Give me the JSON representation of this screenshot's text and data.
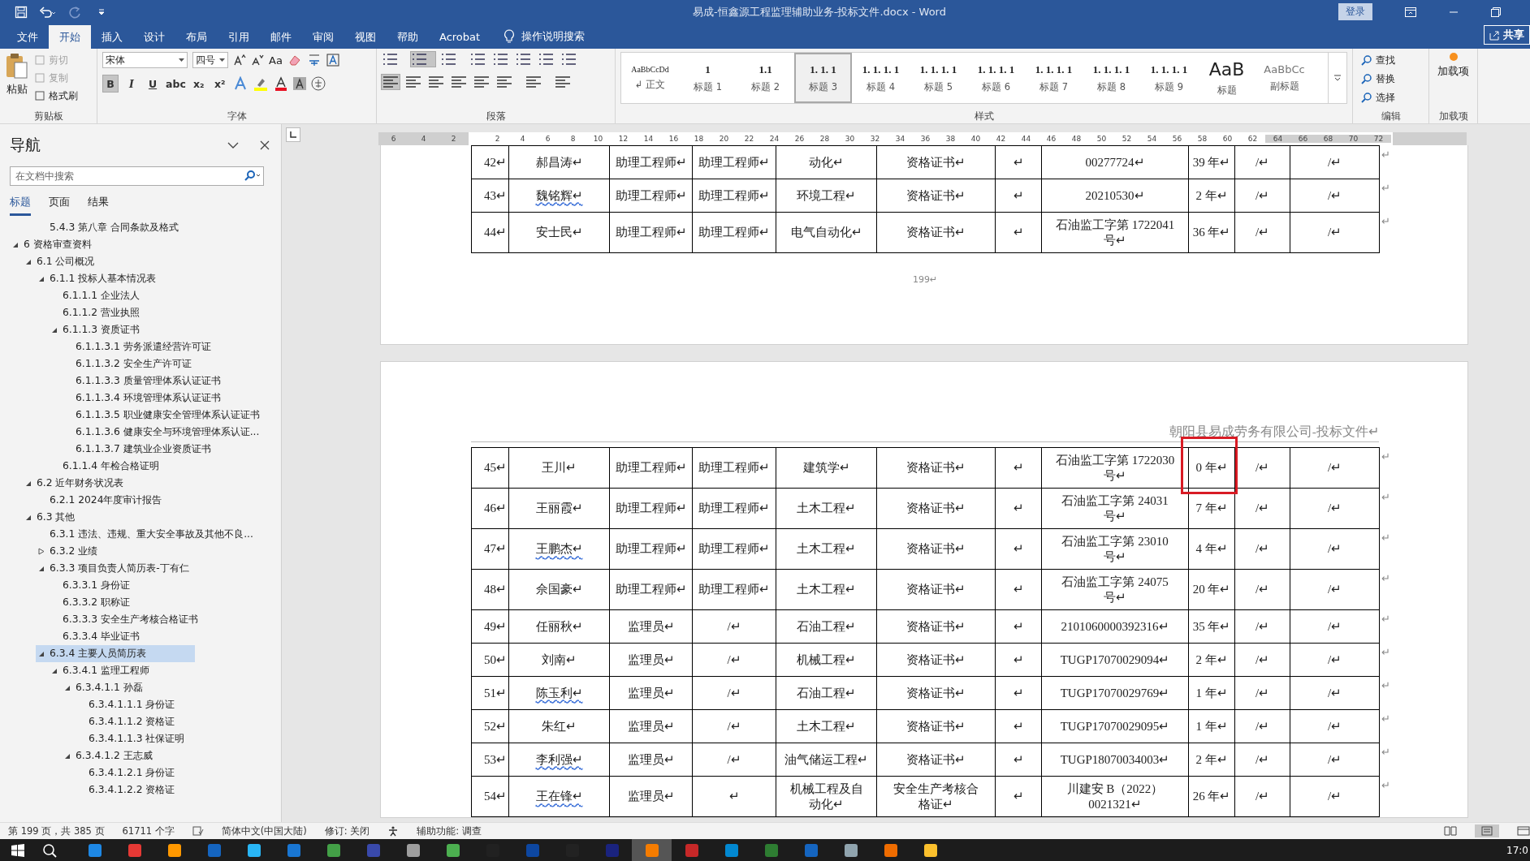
{
  "window": {
    "title": "易成-恒鑫源工程监理辅助业务-投标文件.docx  -  Word",
    "sign_in": "登录"
  },
  "menu_tabs": [
    {
      "label": "文件",
      "selected": false
    },
    {
      "label": "开始",
      "selected": true
    },
    {
      "label": "插入",
      "selected": false
    },
    {
      "label": "设计",
      "selected": false
    },
    {
      "label": "布局",
      "selected": false
    },
    {
      "label": "引用",
      "selected": false
    },
    {
      "label": "邮件",
      "selected": false
    },
    {
      "label": "审阅",
      "selected": false
    },
    {
      "label": "视图",
      "selected": false
    },
    {
      "label": "帮助",
      "selected": false
    },
    {
      "label": "Acrobat",
      "selected": false
    }
  ],
  "tell_me": "操作说明搜索",
  "share": "共享",
  "ribbon": {
    "clipboard": {
      "paste": "粘贴",
      "items": [
        {
          "label": "剪切",
          "disabled": true
        },
        {
          "label": "复制",
          "disabled": true
        },
        {
          "label": "格式刷",
          "disabled": false
        }
      ],
      "group": "剪贴板"
    },
    "font": {
      "name": "宋体",
      "size": "四号",
      "case_button": "Aa",
      "format_buttons": [
        {
          "label": "B",
          "selected": true
        },
        {
          "label": "I",
          "selected": false
        },
        {
          "label": "U",
          "selected": false
        },
        {
          "label": "abc",
          "selected": false
        },
        {
          "label": "x₂",
          "selected": false
        },
        {
          "label": "x²",
          "selected": false
        }
      ],
      "group": "字体"
    },
    "paragraph": {
      "group": "段落"
    },
    "styles": {
      "items": [
        {
          "preview": "AaBbCcDd",
          "name": "↲ 正文",
          "selected": false
        },
        {
          "preview": "1",
          "name": "标题 1",
          "selected": false
        },
        {
          "preview": "1.1",
          "name": "标题 2",
          "selected": false
        },
        {
          "preview": "1. 1. 1",
          "name": "标题 3",
          "selected": true
        },
        {
          "preview": "1. 1. 1. 1",
          "name": "标题 4",
          "selected": false
        },
        {
          "preview": "1. 1. 1. 1",
          "name": "标题 5",
          "selected": false
        },
        {
          "preview": "1. 1. 1. 1",
          "name": "标题 6",
          "selected": false
        },
        {
          "preview": "1. 1. 1. 1",
          "name": "标题 7",
          "selected": false
        },
        {
          "preview": "1. 1. 1. 1",
          "name": "标题 8",
          "selected": false
        },
        {
          "preview": "1. 1. 1. 1",
          "name": "标题 9",
          "selected": false
        },
        {
          "preview": "AaB",
          "name": "标题",
          "selected": false
        },
        {
          "preview": "AaBbCc",
          "name": "副标题",
          "selected": false
        }
      ],
      "group": "样式"
    },
    "editing": {
      "items": [
        "查找",
        "替换",
        "选择"
      ],
      "group": "编辑"
    },
    "addins": {
      "button": "加载项",
      "group": "加载项"
    }
  },
  "navigation": {
    "title": "导航",
    "search": {
      "placeholder": "在文档中搜索"
    },
    "tabs": [
      {
        "label": "标题",
        "selected": true
      },
      {
        "label": "页面",
        "selected": false
      },
      {
        "label": "结果",
        "selected": false
      }
    ],
    "scrolled_item": {
      "label": "5.4.3 第八章  合同条款及格式"
    },
    "items": [
      {
        "label": "6 资格审查资料",
        "expanded": true,
        "selected": false,
        "children": [
          {
            "label": "6.1 公司概况",
            "expanded": true,
            "selected": false,
            "children": [
              {
                "label": "6.1.1 投标人基本情况表",
                "expanded": true,
                "selected": false,
                "children": [
                  {
                    "label": "6.1.1.1 企业法人",
                    "selected": false
                  },
                  {
                    "label": "6.1.1.2 营业执照",
                    "selected": false
                  },
                  {
                    "label": "6.1.1.3 资质证书",
                    "expanded": true,
                    "selected": false,
                    "children": [
                      {
                        "label": "6.1.1.3.1 劳务派遣经营许可证",
                        "selected": false
                      },
                      {
                        "label": "6.1.1.3.2 安全生产许可证",
                        "selected": false
                      },
                      {
                        "label": "6.1.1.3.3 质量管理体系认证证书",
                        "selected": false
                      },
                      {
                        "label": "6.1.1.3.4 环境管理体系认证证书",
                        "selected": false
                      },
                      {
                        "label": "6.1.1.3.5 职业健康安全管理体系认证证书",
                        "selected": false
                      },
                      {
                        "label": "6.1.1.3.6 健康安全与环境管理体系认证...",
                        "selected": false
                      },
                      {
                        "label": "6.1.1.3.7 建筑业企业资质证书",
                        "selected": false
                      }
                    ]
                  },
                  {
                    "label": "6.1.1.4 年检合格证明",
                    "selected": false
                  }
                ]
              }
            ]
          },
          {
            "label": "6.2 近年财务状况表",
            "expanded": true,
            "selected": false,
            "children": [
              {
                "label": "6.2.1 2024年度审计报告",
                "selected": false
              }
            ]
          },
          {
            "label": "6.3 其他",
            "expanded": true,
            "selected": false,
            "children": [
              {
                "label": "6.3.1 违法、违规、重大安全事故及其他不良...",
                "selected": false
              },
              {
                "label": "6.3.2 业绩",
                "expanded": false,
                "selected": false
              },
              {
                "label": "6.3.3 项目负责人简历表-丁有仁",
                "expanded": true,
                "selected": false,
                "children": [
                  {
                    "label": "6.3.3.1 身份证",
                    "selected": false
                  },
                  {
                    "label": "6.3.3.2 职称证",
                    "selected": false
                  },
                  {
                    "label": "6.3.3.3 安全生产考核合格证书",
                    "selected": false
                  },
                  {
                    "label": "6.3.3.4 毕业证书",
                    "selected": false
                  }
                ]
              },
              {
                "label": "6.3.4 主要人员简历表",
                "expanded": true,
                "selected": true,
                "children": [
                  {
                    "label": "6.3.4.1 监理工程师",
                    "expanded": true,
                    "selected": false,
                    "children": [
                      {
                        "label": "6.3.4.1.1 孙磊",
                        "expanded": true,
                        "selected": false,
                        "children": [
                          {
                            "label": "6.3.4.1.1.1 身份证",
                            "selected": false
                          },
                          {
                            "label": "6.3.4.1.1.2 资格证",
                            "selected": false
                          },
                          {
                            "label": "6.3.4.1.1.3 社保证明",
                            "selected": false
                          }
                        ]
                      },
                      {
                        "label": "6.3.4.1.2 王志威",
                        "expanded": true,
                        "selected": false,
                        "children": [
                          {
                            "label": "6.3.4.1.2.1 身份证",
                            "selected": false
                          },
                          {
                            "label": "6.3.4.1.2.2 资格证",
                            "selected": false
                          }
                        ]
                      }
                    ]
                  }
                ]
              }
            ]
          }
        ]
      }
    ]
  },
  "ruler": {
    "left_numbers": [
      "6",
      "4",
      "2"
    ],
    "right_numbers": [
      "2",
      "4",
      "6",
      "8",
      "10",
      "12",
      "14",
      "16",
      "18",
      "20",
      "22",
      "24",
      "26",
      "28",
      "30",
      "32",
      "34",
      "36",
      "38",
      "40",
      "42",
      "44",
      "46",
      "48",
      "50",
      "52",
      "54",
      "56",
      "58",
      "60",
      "62",
      "64",
      "66",
      "68",
      "70",
      "72"
    ]
  },
  "pages": [
    {
      "rows": [
        {
          "cells": [
            "42↵",
            "郝昌涛↵",
            "助理工程师↵",
            "助理工程师↵",
            "动化↵",
            "资格证书↵",
            "↵",
            "00277724↵",
            "39 年↵",
            "/↵",
            "/↵"
          ],
          "end_mark": "↵",
          "flagged_name": false
        },
        {
          "cells": [
            "43↵",
            "魏铭辉↵",
            "助理工程师↵",
            "助理工程师↵",
            "环境工程↵",
            "资格证书↵",
            "↵",
            "20210530↵",
            "2 年↵",
            "/↵",
            "/↵"
          ],
          "end_mark": "↵",
          "flagged_name": true
        },
        {
          "cells": [
            "44↵",
            "安士民↵",
            "助理工程师↵",
            "助理工程师↵",
            "电气自动化↵",
            "资格证书↵",
            "↵",
            "石油监工字第 1722041\n号↵",
            "36 年↵",
            "/↵",
            "/↵"
          ],
          "end_mark": "↵",
          "flagged_name": false
        }
      ],
      "page_number": "199↵"
    },
    {
      "header": "朝阳县易成劳务有限公司-投标文件↵",
      "rows": [
        {
          "cells": [
            "45↵",
            "王川↵",
            "助理工程师↵",
            "助理工程师↵",
            "建筑学↵",
            "资格证书↵",
            "↵",
            "石油监工字第 1722030\n号↵",
            "0 年↵",
            "/↵",
            "/↵"
          ],
          "end_mark": "↵",
          "flagged_name": false,
          "years_marked": true
        },
        {
          "cells": [
            "46↵",
            "王丽霞↵",
            "助理工程师↵",
            "助理工程师↵",
            "土木工程↵",
            "资格证书↵",
            "↵",
            "石油监工字第 24031\n号↵",
            "7 年↵",
            "/↵",
            "/↵"
          ],
          "end_mark": "↵",
          "flagged_name": false
        },
        {
          "cells": [
            "47↵",
            "王鹏杰↵",
            "助理工程师↵",
            "助理工程师↵",
            "土木工程↵",
            "资格证书↵",
            "↵",
            "石油监工字第 23010\n号↵",
            "4 年↵",
            "/↵",
            "/↵"
          ],
          "end_mark": "↵",
          "flagged_name": true
        },
        {
          "cells": [
            "48↵",
            "佘国豪↵",
            "助理工程师↵",
            "助理工程师↵",
            "土木工程↵",
            "资格证书↵",
            "↵",
            "石油监工字第 24075\n号↵",
            "20 年↵",
            "/↵",
            "/↵"
          ],
          "end_mark": "↵",
          "flagged_name": false
        },
        {
          "cells": [
            "49↵",
            "任丽秋↵",
            "监理员↵",
            "/↵",
            "石油工程↵",
            "资格证书↵",
            "↵",
            "2101060000392316↵",
            "35 年↵",
            "/↵",
            "/↵"
          ],
          "end_mark": "↵",
          "flagged_name": false
        },
        {
          "cells": [
            "50↵",
            "刘南↵",
            "监理员↵",
            "/↵",
            "机械工程↵",
            "资格证书↵",
            "↵",
            "TUGP17070029094↵",
            "2 年↵",
            "/↵",
            "/↵"
          ],
          "end_mark": "↵",
          "flagged_name": false
        },
        {
          "cells": [
            "51↵",
            "陈玉利↵",
            "监理员↵",
            "/↵",
            "石油工程↵",
            "资格证书↵",
            "↵",
            "TUGP17070029769↵",
            "1 年↵",
            "/↵",
            "/↵"
          ],
          "end_mark": "↵",
          "flagged_name": true
        },
        {
          "cells": [
            "52↵",
            "朱红↵",
            "监理员↵",
            "/↵",
            "土木工程↵",
            "资格证书↵",
            "↵",
            "TUGP17070029095↵",
            "1 年↵",
            "/↵",
            "/↵"
          ],
          "end_mark": "↵",
          "flagged_name": false
        },
        {
          "cells": [
            "53↵",
            "李利强↵",
            "监理员↵",
            "/↵",
            "油气储运工程↵",
            "资格证书↵",
            "↵",
            "TUGP18070034003↵",
            "2 年↵",
            "/↵",
            "/↵"
          ],
          "end_mark": "↵",
          "flagged_name": true
        },
        {
          "cells": [
            "54↵",
            "王在锋↵",
            "监理员↵",
            "↵",
            "机械工程及自动化↵",
            "安全生产考核合格证↵",
            "↵",
            "川建安 B（2022）\n0021321↵",
            "26 年↵",
            "/↵",
            "/↵"
          ],
          "end_mark": "↵",
          "flagged_name": true
        }
      ]
    }
  ],
  "status_bar": {
    "items": [
      "第 199 页，共 385 页",
      "61711 个字",
      "简体中文(中国大陆)",
      "修订: 关闭",
      "辅助功能: 调查"
    ]
  },
  "taskbar": {
    "apps": [
      {
        "color": "#1e88e5"
      },
      {
        "color": "#e53935"
      },
      {
        "color": "#ff9800"
      },
      {
        "color": "#1565c0"
      },
      {
        "color": "#29b6f6"
      },
      {
        "color": "#1976d2"
      },
      {
        "color": "#43a047"
      },
      {
        "color": "#3949ab"
      },
      {
        "color": "#9e9e9e"
      },
      {
        "color": "#4caf50"
      },
      {
        "color": "#212121"
      },
      {
        "color": "#0d47a1"
      },
      {
        "color": "#222222"
      },
      {
        "color": "#1a237e"
      },
      {
        "color": "#f57c00"
      },
      {
        "color": "#c62828"
      },
      {
        "color": "#0288d1"
      },
      {
        "color": "#2e7d32"
      },
      {
        "color": "#1565c0"
      },
      {
        "color": "#90a4ae"
      },
      {
        "color": "#ef6c00"
      },
      {
        "color": "#fbc02d"
      }
    ],
    "clock": "17:0"
  }
}
